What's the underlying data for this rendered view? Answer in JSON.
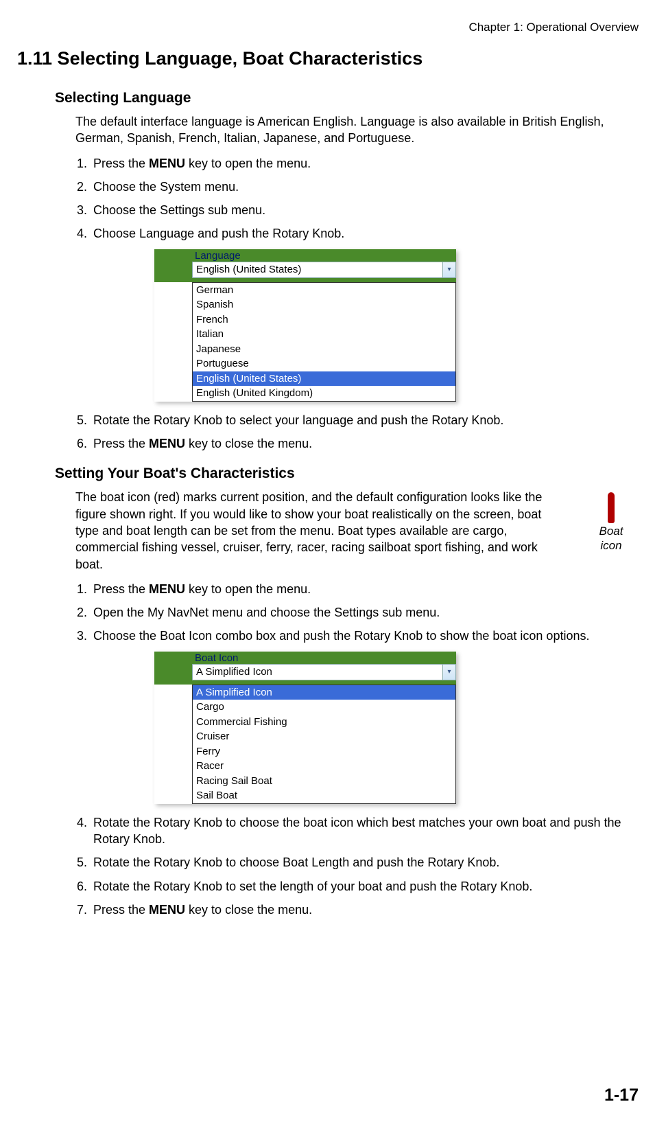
{
  "chapter_header": "Chapter 1: Operational Overview",
  "section_title": "1.11  Selecting Language, Boat Characteristics",
  "sub1_title": "Selecting Language",
  "sub1_intro": "The default interface language is American English. Language is also available in British English, German, Spanish, French, Italian, Japanese, and Portuguese.",
  "sub1_steps": {
    "s1a": "Press the ",
    "s1b": "MENU",
    "s1c": " key to open the menu.",
    "s2": "Choose the System menu.",
    "s3": "Choose the Settings sub menu.",
    "s4": "Choose Language and push the Rotary Knob.",
    "s5": "Rotate the Rotary Knob to select your language and push the Rotary Knob.",
    "s6a": "Press the ",
    "s6b": "MENU",
    "s6c": " key to close the menu."
  },
  "lang_ui": {
    "label": "Language",
    "selected": "English (United States)",
    "items": [
      "German",
      "Spanish",
      "French",
      "Italian",
      "Japanese",
      "Portuguese",
      "English (United States)",
      "English (United Kingdom)"
    ],
    "highlight_index": 6
  },
  "sub2_title": "Setting Your Boat's Characteristics",
  "sub2_intro": "The boat icon (red) marks current position, and the default configuration looks like the figure shown right. If you would like to show your boat realistically on the screen, boat type and boat length can be set from the menu. Boat types available are cargo, commercial fishing vessel, cruiser, ferry, racer, racing sailboat sport fishing, and work boat.",
  "boat_icon_label": "Boat icon",
  "sub2_steps": {
    "s1a": "Press the ",
    "s1b": "MENU",
    "s1c": " key to open the menu.",
    "s2": "Open the My NavNet menu and choose the Settings sub menu.",
    "s3": "Choose the Boat Icon combo box and push the Rotary Knob to show the boat icon options.",
    "s4": "Rotate the Rotary Knob to choose the boat icon which best matches your own boat and push the Rotary Knob.",
    "s5": "Rotate the Rotary Knob to choose Boat Length and push the Rotary Knob.",
    "s6": "Rotate the Rotary Knob to set the length of your boat and push the Rotary Knob.",
    "s7a": "Press the ",
    "s7b": "MENU",
    "s7c": " key to close the menu."
  },
  "boat_ui": {
    "label": "Boat Icon",
    "selected": "A Simplified Icon",
    "items": [
      "A Simplified Icon",
      "Cargo",
      "Commercial Fishing",
      "Cruiser",
      "Ferry",
      "Racer",
      "Racing Sail Boat",
      "Sail Boat"
    ],
    "highlight_index": 0
  },
  "page_number": "1-17"
}
